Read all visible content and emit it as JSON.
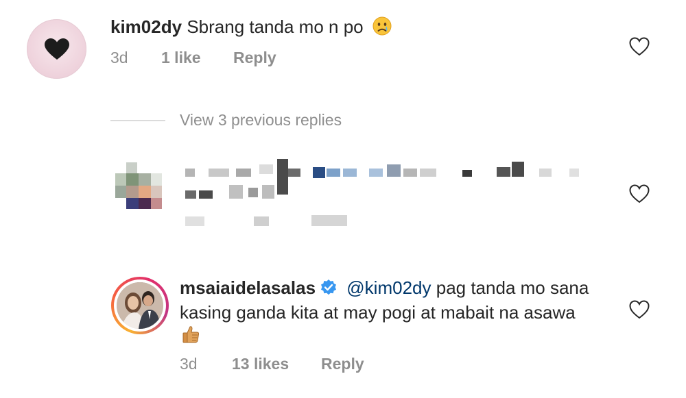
{
  "comment": {
    "username": "kim02dy",
    "text": "Sbrang tanda mo n po",
    "time": "3d",
    "likes": "1 like",
    "reply_label": "Reply"
  },
  "view_replies": {
    "label": "View 3 previous replies"
  },
  "reply": {
    "username": "msaiaidelasalas",
    "mention": "@kim02dy",
    "text_line1": "pag tanda mo sana",
    "text_line2": "kasing ganda kita at may pogi at mabait na asawa",
    "time": "3d",
    "likes": "13 likes",
    "reply_label": "Reply"
  },
  "icons": {
    "avatar1": "black-heart-icon",
    "emoji1": "crying-face-emoji",
    "verified": "verified-badge-icon",
    "emoji2": "thumbs-up-emoji",
    "like": "heart-outline-icon"
  },
  "colors": {
    "text": "#262626",
    "meta": "#8e8e8e",
    "mention": "#00376b",
    "verified": "#3897f0"
  }
}
